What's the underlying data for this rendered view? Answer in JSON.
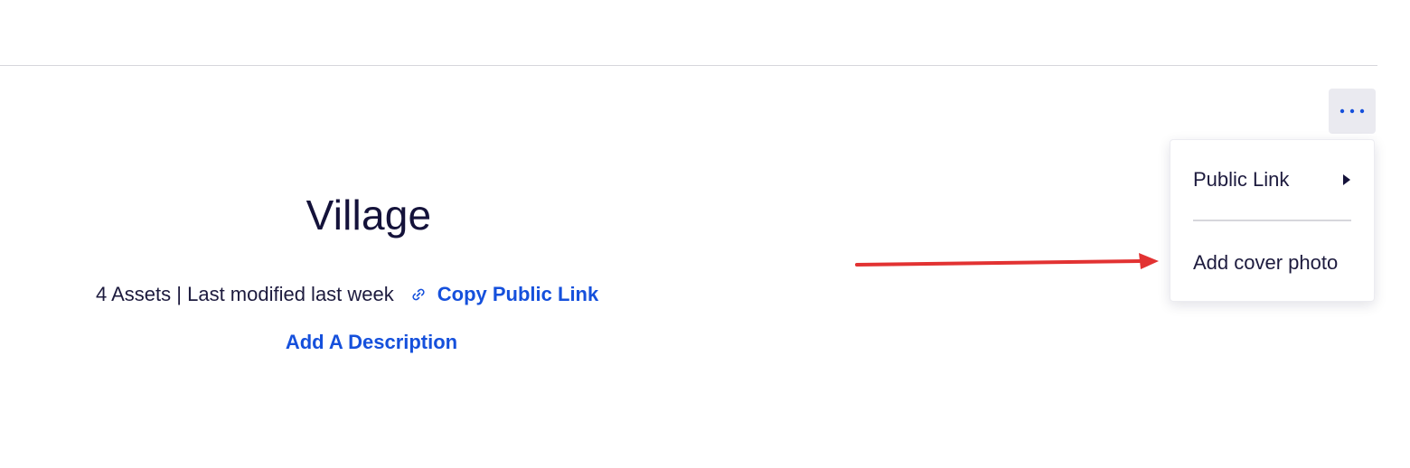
{
  "page": {
    "title": "Village",
    "meta": "4 Assets | Last modified last week",
    "copy_link_label": "Copy Public Link",
    "add_description_label": "Add A Description"
  },
  "more_button": {
    "icon": "more-horizontal-icon"
  },
  "menu": {
    "items": [
      {
        "label": "Public Link",
        "icon": "caret-right-icon"
      },
      {
        "label": "Add cover photo"
      }
    ]
  },
  "colors": {
    "title": "#14123a",
    "link": "#1550dc",
    "annotation_arrow": "#e23232",
    "button_bg": "#eaeaf0"
  }
}
